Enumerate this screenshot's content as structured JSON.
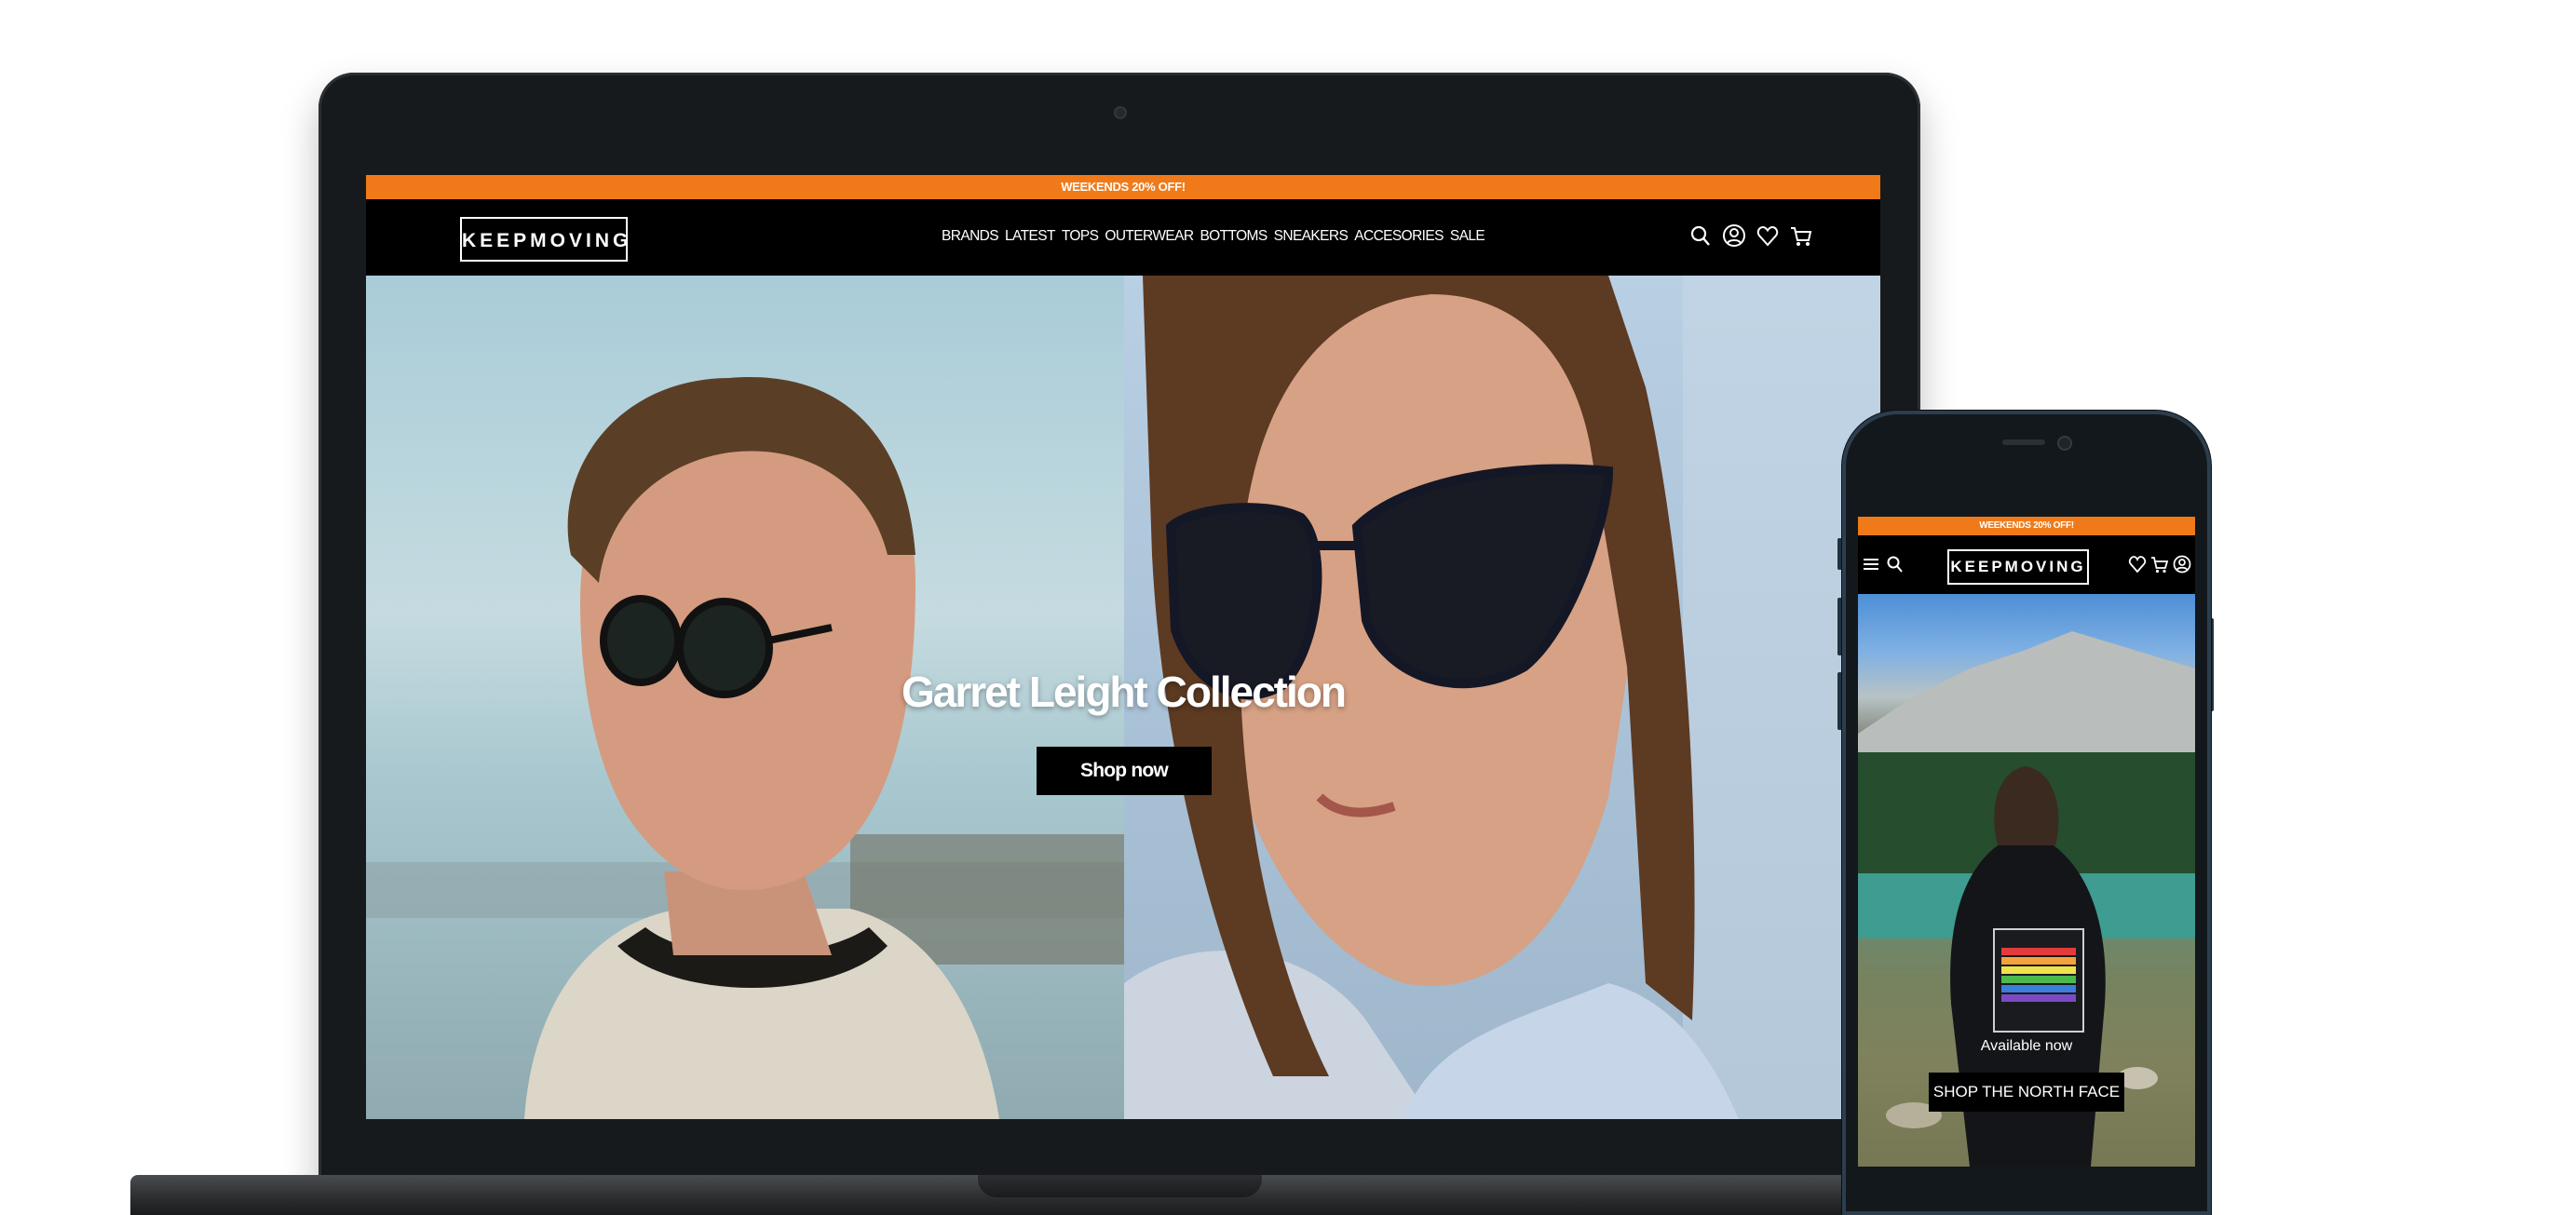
{
  "desktop": {
    "promo_banner": "WEEKENDS 20% OFF!",
    "logo": "KEEPMOVING",
    "nav_links": [
      "BRANDS",
      "LATEST",
      "TOPS",
      "OUTERWEAR",
      "BOTTOMS",
      "SNEAKERS",
      "ACCESORIES",
      "SALE"
    ],
    "icons": [
      "search-icon",
      "account-icon",
      "wishlist-heart-icon",
      "cart-icon"
    ],
    "hero": {
      "title": "Garret Leight Collection",
      "button": "Shop now"
    }
  },
  "mobile": {
    "promo_banner": "WEEKENDS 20% OFF!",
    "logo": "KEEPMOVING",
    "left_icons": [
      "menu-icon",
      "search-icon"
    ],
    "right_icons": [
      "wishlist-heart-icon",
      "cart-icon",
      "account-icon"
    ],
    "hero": {
      "caption": "Available now",
      "button": "SHOP THE NORTH FACE"
    }
  },
  "colors": {
    "accent_orange": "#f07a19",
    "nav_background": "#000000",
    "text_white": "#ffffff"
  }
}
